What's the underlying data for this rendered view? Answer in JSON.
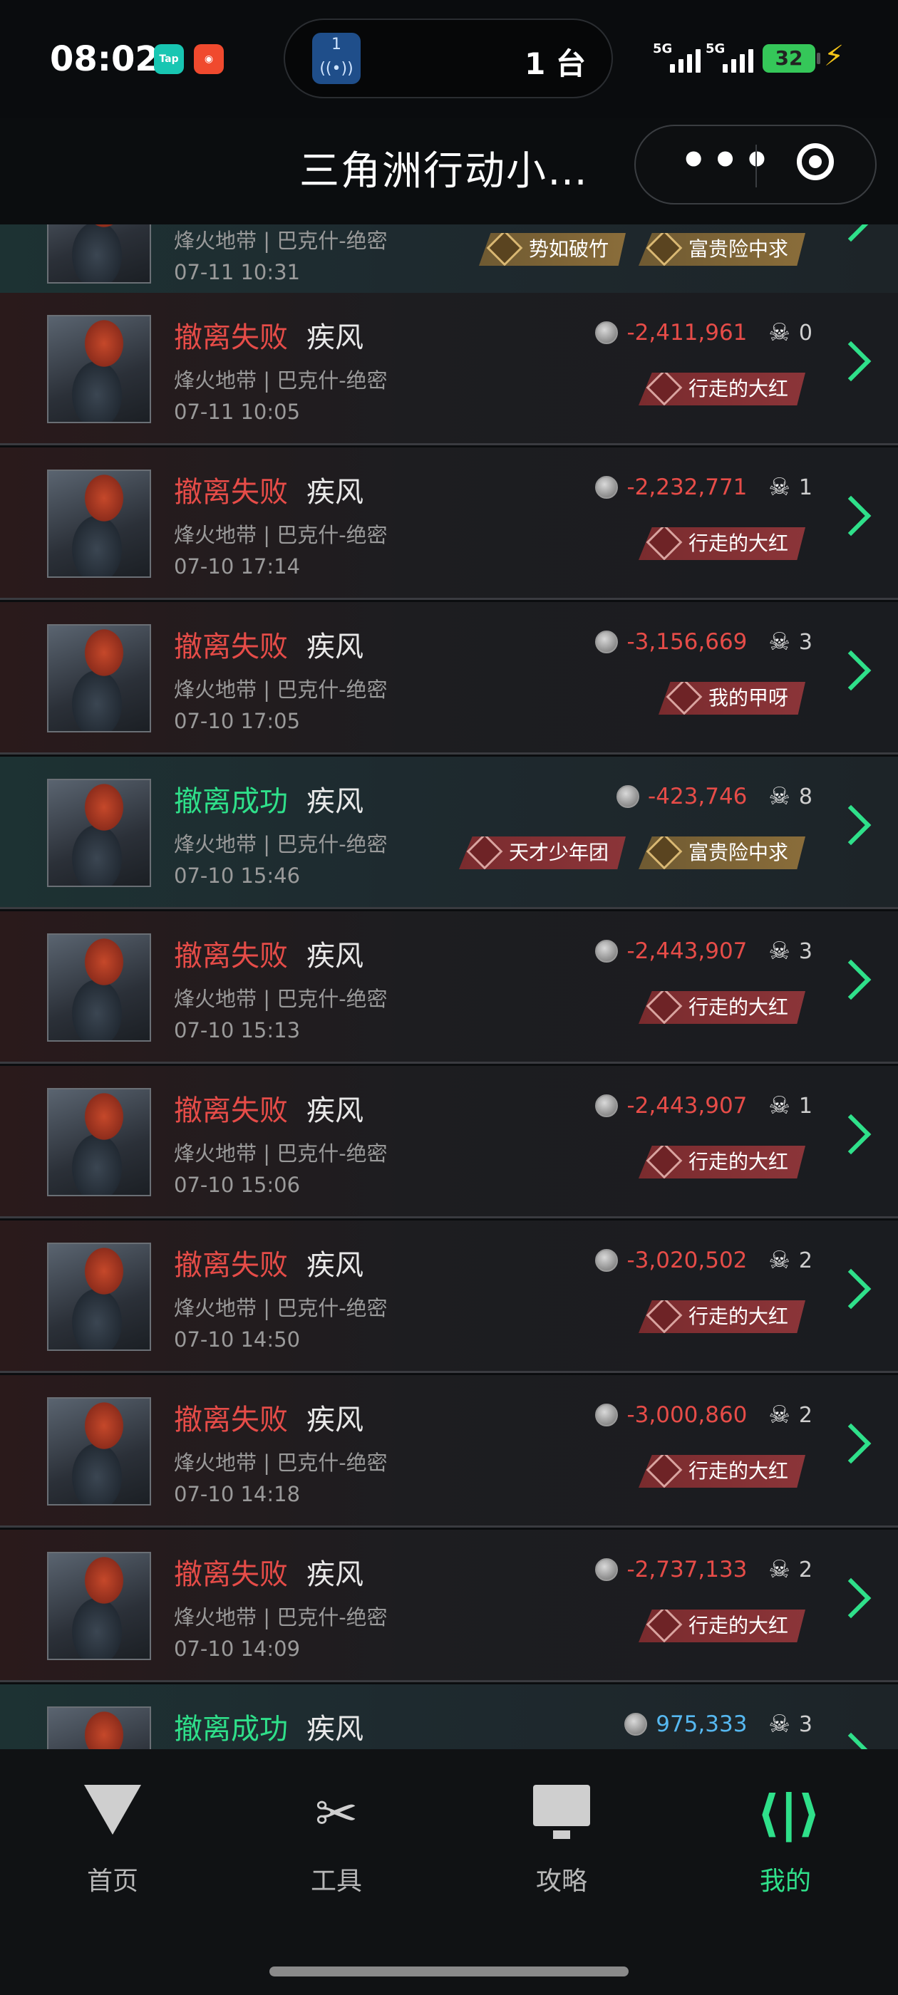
{
  "status_bar": {
    "time": "08:02",
    "app_icon_1": "Tap",
    "island_badge": "1",
    "island_text": "1 台",
    "signal_1": "5G",
    "signal_2": "5G",
    "battery": "32"
  },
  "header": {
    "title": "三角洲行动小…"
  },
  "partial_top": {
    "map": "烽火地带 | 巴克什-绝密",
    "time": "07-11 10:31",
    "badges": [
      "势如破竹",
      "富贵险中求"
    ],
    "badge_types": [
      "gold",
      "gold"
    ]
  },
  "records": [
    {
      "status": "撤离失败",
      "result": "fail",
      "operator": "疾风",
      "map": "烽火地带 | 巴克什-绝密",
      "time": "07-11 10:05",
      "value": "-2,411,961",
      "kills": "0",
      "badges": [
        "行走的大红"
      ],
      "badge_types": [
        "red"
      ]
    },
    {
      "status": "撤离失败",
      "result": "fail",
      "operator": "疾风",
      "map": "烽火地带 | 巴克什-绝密",
      "time": "07-10 17:14",
      "value": "-2,232,771",
      "kills": "1",
      "badges": [
        "行走的大红"
      ],
      "badge_types": [
        "red"
      ]
    },
    {
      "status": "撤离失败",
      "result": "fail",
      "operator": "疾风",
      "map": "烽火地带 | 巴克什-绝密",
      "time": "07-10 17:05",
      "value": "-3,156,669",
      "kills": "3",
      "badges": [
        "我的甲呀"
      ],
      "badge_types": [
        "red"
      ]
    },
    {
      "status": "撤离成功",
      "result": "success",
      "operator": "疾风",
      "map": "烽火地带 | 巴克什-绝密",
      "time": "07-10 15:46",
      "value": "-423,746",
      "kills": "8",
      "badges": [
        "天才少年团",
        "富贵险中求"
      ],
      "badge_types": [
        "red",
        "gold"
      ]
    },
    {
      "status": "撤离失败",
      "result": "fail",
      "operator": "疾风",
      "map": "烽火地带 | 巴克什-绝密",
      "time": "07-10 15:13",
      "value": "-2,443,907",
      "kills": "3",
      "badges": [
        "行走的大红"
      ],
      "badge_types": [
        "red"
      ]
    },
    {
      "status": "撤离失败",
      "result": "fail",
      "operator": "疾风",
      "map": "烽火地带 | 巴克什-绝密",
      "time": "07-10 15:06",
      "value": "-2,443,907",
      "kills": "1",
      "badges": [
        "行走的大红"
      ],
      "badge_types": [
        "red"
      ]
    },
    {
      "status": "撤离失败",
      "result": "fail",
      "operator": "疾风",
      "map": "烽火地带 | 巴克什-绝密",
      "time": "07-10 14:50",
      "value": "-3,020,502",
      "kills": "2",
      "badges": [
        "行走的大红"
      ],
      "badge_types": [
        "red"
      ]
    },
    {
      "status": "撤离失败",
      "result": "fail",
      "operator": "疾风",
      "map": "烽火地带 | 巴克什-绝密",
      "time": "07-10 14:18",
      "value": "-3,000,860",
      "kills": "2",
      "badges": [
        "行走的大红"
      ],
      "badge_types": [
        "red"
      ]
    },
    {
      "status": "撤离失败",
      "result": "fail",
      "operator": "疾风",
      "map": "烽火地带 | 巴克什-绝密",
      "time": "07-10 14:09",
      "value": "-2,737,133",
      "kills": "2",
      "badges": [
        "行走的大红"
      ],
      "badge_types": [
        "red"
      ]
    },
    {
      "status": "撤离成功",
      "result": "success",
      "operator": "疾风",
      "map": "",
      "time": "",
      "value": "975,333",
      "value_positive": true,
      "kills": "3",
      "badges": [],
      "badge_types": []
    }
  ],
  "nav": {
    "items": [
      {
        "label": "首页",
        "icon": "home-icon"
      },
      {
        "label": "工具",
        "icon": "tools-icon"
      },
      {
        "label": "攻略",
        "icon": "guide-icon"
      },
      {
        "label": "我的",
        "icon": "mine-icon",
        "active": true
      }
    ]
  },
  "colors": {
    "fail": "#e64c48",
    "success": "#2fe08a",
    "positive_value": "#56b8f0",
    "accent": "#2fe08a"
  }
}
